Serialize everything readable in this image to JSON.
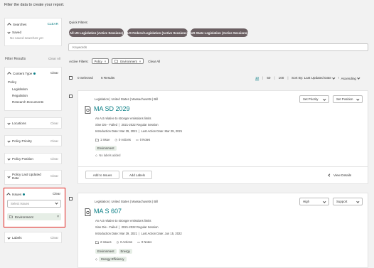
{
  "header": {
    "instruction": "Filter the data to create your report."
  },
  "searches": {
    "title": "Searches",
    "clear": "CLEAR",
    "saved_label": "Saved",
    "empty": "No saved searches yet"
  },
  "filter_results": {
    "title": "Filter Results",
    "clear_all": "Clear All"
  },
  "content_type": {
    "title": "Content Type",
    "clear": "Clear",
    "group": "Policy",
    "options": [
      "Legislation",
      "Regulation",
      "Research Documents"
    ]
  },
  "sections": {
    "locations": {
      "title": "Locations",
      "clear": "Clear"
    },
    "policy_priority": {
      "title": "Policy Priority",
      "clear": "Clear"
    },
    "policy_position": {
      "title": "Policy Position",
      "clear": "Clear"
    },
    "policy_last_updated": {
      "title": "Policy Last Updated Date",
      "clear": "Clear"
    },
    "labels": {
      "title": "Labels",
      "clear": "Clear"
    }
  },
  "issues": {
    "title": "Issues",
    "clear": "Clear",
    "placeholder": "Select Issues",
    "selected": "Environment"
  },
  "quick_filters": {
    "title": "Quick Filters:",
    "items": [
      "All US Legislation (Active Sessions)",
      "US Federal Legislation (Active Sessions)",
      "US State Legislation (Active Sessions)"
    ]
  },
  "keywords": {
    "placeholder": "Keywords"
  },
  "active_filters": {
    "label": "Active Filters:",
    "items": [
      "Policy",
      "Environment"
    ],
    "clear_all": "Clear All"
  },
  "results_bar": {
    "selected": "0 Selected",
    "count": "6 Results",
    "page_sizes": [
      "10",
      "50",
      "100"
    ],
    "sort_by": "Sort By: Last Updated Date",
    "order": "Ascending"
  },
  "results": [
    {
      "breadcrumb": [
        "Legislation",
        "United States",
        "Massachusetts",
        "Bill"
      ],
      "bill_id": "MA SD 2029",
      "description": "An Act relative to stronger emissions limits",
      "status": "Sine Die - Failed",
      "session": "2021-2022 Regular Session",
      "introduction": "Introduction Date: Mar 29, 2021",
      "last_action": "Last Action Date: Mar 29, 2021",
      "issues_count": "1 Issue",
      "actions_count": "0 Actions",
      "notes_count": "0 Notes",
      "issue_tags": [
        "Environment"
      ],
      "label_text": "No labels added",
      "priority": "Set Priority",
      "position": "Set Position",
      "add_to_issues": "Add to Issues",
      "add_labels": "Add Labels",
      "view_details": "View Details"
    },
    {
      "breadcrumb": [
        "Legislation",
        "United States",
        "Massachusetts",
        "Bill"
      ],
      "bill_id": "MA S 607",
      "description": "An Act relative to stronger emissions limits",
      "status": "Sine Die - Failed",
      "session": "2021-2022 Regular Session",
      "introduction": "Introduction Date: Mar 29, 2021",
      "last_action": "Last Action Date: Jun 15, 2022",
      "issues_count": "2 Issues",
      "actions_count": "0 Actions",
      "notes_count": "0 Notes",
      "issue_tags": [
        "Environment",
        "Energy"
      ],
      "label_text": "Energy Efficiency",
      "priority": "High",
      "position": "Support"
    }
  ],
  "colors": {
    "accent": "#0b7f86",
    "highlight": "#e0201c",
    "pill_bg": "#6b5f62"
  }
}
